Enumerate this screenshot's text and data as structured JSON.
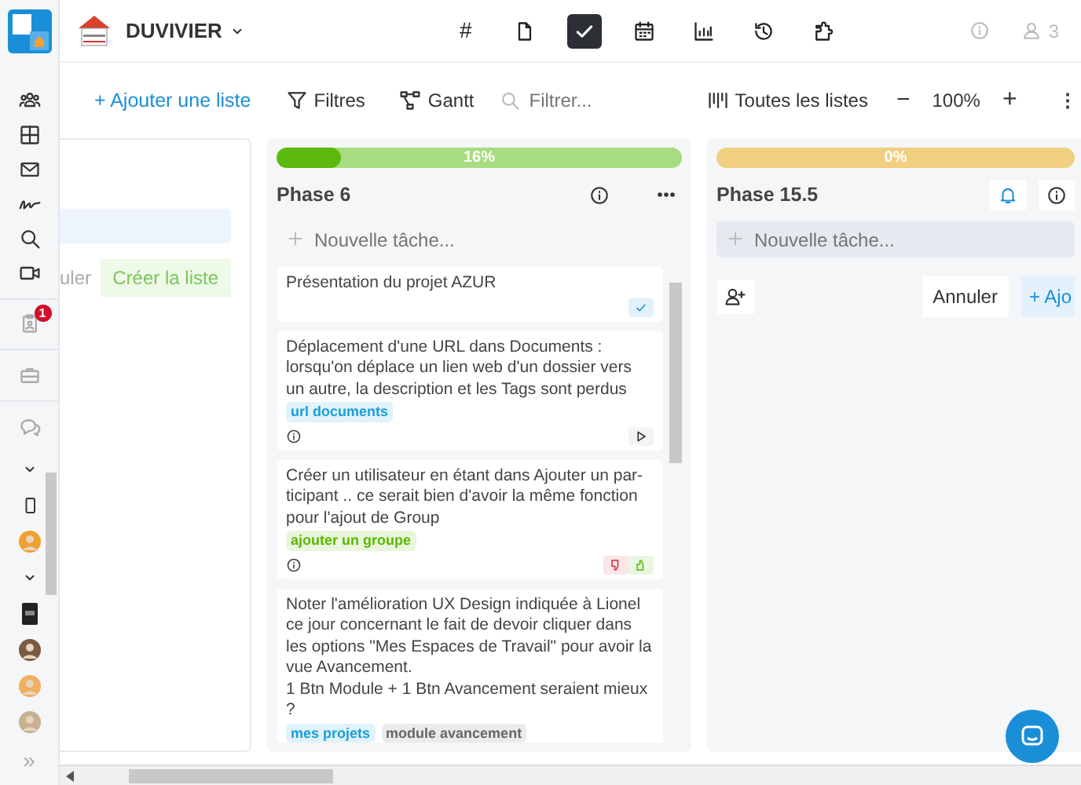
{
  "header": {
    "company": "DUVIVIER",
    "nav": [
      {
        "kind": "hash",
        "glyph": "#",
        "selected": false
      },
      {
        "kind": "file",
        "selected": false
      },
      {
        "kind": "check",
        "selected": true
      },
      {
        "kind": "calendar",
        "selected": false
      },
      {
        "kind": "chart",
        "selected": false
      },
      {
        "kind": "history",
        "selected": false
      },
      {
        "kind": "puzzle",
        "selected": false
      }
    ],
    "user_count": "3"
  },
  "sidebar": {
    "items": [
      {
        "kind": "team"
      },
      {
        "kind": "grid"
      },
      {
        "kind": "mail"
      },
      {
        "kind": "signature"
      },
      {
        "kind": "search"
      },
      {
        "kind": "video"
      },
      {
        "kind": "clipboard",
        "badge": "1"
      },
      {
        "kind": "briefcase"
      },
      {
        "kind": "chat"
      }
    ],
    "groups": [
      {
        "kind": "chevron"
      },
      {
        "kind": "phone"
      },
      {
        "kind": "avatar",
        "color": "#f0a030"
      },
      {
        "kind": "chevron"
      },
      {
        "kind": "device"
      },
      {
        "kind": "avatar",
        "color": "#7a5a40"
      },
      {
        "kind": "avatar",
        "color": "#f0b060"
      },
      {
        "kind": "avatar",
        "color": "#c8b090"
      }
    ],
    "collapse": "»"
  },
  "toolbar": {
    "add_list": "+ Ajouter une liste",
    "filters": "Filtres",
    "gantt": "Gantt",
    "search": {
      "placeholder": "Filtrer..."
    },
    "all_lists": "Toutes les listes",
    "zoom_out": "−",
    "zoom": "100%",
    "zoom_in": "+",
    "more": "⋮"
  },
  "new_list": {
    "cancel": "uler",
    "create": "Créer la liste"
  },
  "lists": [
    {
      "title": "Phase 6",
      "level": 0.16,
      "percent": "16%",
      "color": "#a8dc80",
      "new_task": {
        "placeholder": "Nouvelle tâche...",
        "active": false
      },
      "tasks": [
        {
          "text": "Présentation du projet AZUR",
          "kind": "done"
        },
        {
          "text": "Déplacement d'une URL dans Documents : lorsqu'on déplace un lien web d'un dossier vers un autre, la description et les Tags sont perdus",
          "tags": [
            {
              "label": "url documents",
              "color": "#1a9fd8"
            }
          ],
          "kind": "play"
        },
        {
          "text": "Créer un utilisateur en étant dans Ajouter un par-ticipant .. ce serait bien d'avoir la même fonction pour l'ajout de Group",
          "tags": [
            {
              "label": "ajouter un groupe",
              "color": "#5cb800"
            }
          ],
          "kind": "votes"
        },
        {
          "text": "Noter l'amélioration UX Design indiquée à Lionel ce jour concernant le fait de devoir cliquer dans les options \"Mes Espaces de Travail\" pour avoir la vue Avancement.\n1 Btn Module + 1 Btn Avancement seraient mieux ?",
          "tags": [
            {
              "label": "mes projets",
              "color": "#1a9fd8"
            },
            {
              "label": "module avancement",
              "color": "#666666"
            }
          ],
          "kind": "plain"
        }
      ]
    },
    {
      "title": "Phase 15.5",
      "level": 0,
      "percent": "0%",
      "color": "#f0d080",
      "new_task": {
        "placeholder": "Nouvelle tâche...",
        "active": true,
        "cancel": "Annuler",
        "add": "+ Ajo"
      }
    }
  ]
}
